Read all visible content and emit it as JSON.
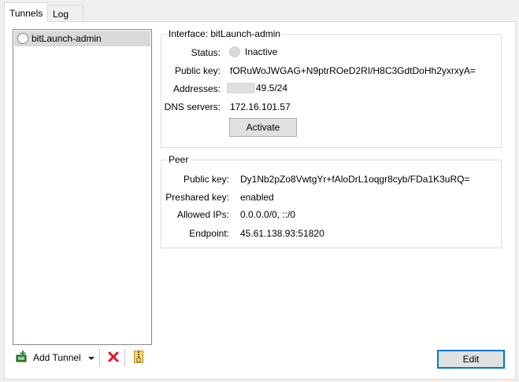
{
  "tabs": [
    {
      "label": "Tunnels",
      "active": true
    },
    {
      "label": "Log",
      "active": false
    }
  ],
  "tunnels": [
    {
      "name": "bitLaunch-admin",
      "status": "inactive"
    }
  ],
  "toolbar": {
    "add_label": "Add Tunnel",
    "icons": [
      "add-tunnel-icon",
      "chevron-down-icon",
      "delete-icon",
      "export-zip-icon"
    ]
  },
  "interface": {
    "title": "Interface: bitLaunch-admin",
    "status_label": "Status:",
    "status_value": "Inactive",
    "public_key_label": "Public key:",
    "public_key_value": "fORuWoJWGAG+N9ptrROeD2RI/H8C3GdtDoHh2yxrxyA=",
    "addresses_label": "Addresses:",
    "addresses_value": "49.5/24",
    "dns_label": "DNS servers:",
    "dns_value": "172.16.101.57",
    "activate_label": "Activate"
  },
  "peer": {
    "title": "Peer",
    "public_key_label": "Public key:",
    "public_key_value": "Dy1Nb2pZo8VwtgYr+fAloDrL1oqgr8cyb/FDa1K3uRQ=",
    "preshared_label": "Preshared key:",
    "preshared_value": "enabled",
    "allowed_ips_label": "Allowed IPs:",
    "allowed_ips_value": "0.0.0.0/0, ::/0",
    "endpoint_label": "Endpoint:",
    "endpoint_value": "45.61.138.93:51820"
  },
  "edit_label": "Edit",
  "colors": {
    "accent": "#0078d7",
    "delete": "#e81123",
    "add": "#2e8b2e"
  }
}
